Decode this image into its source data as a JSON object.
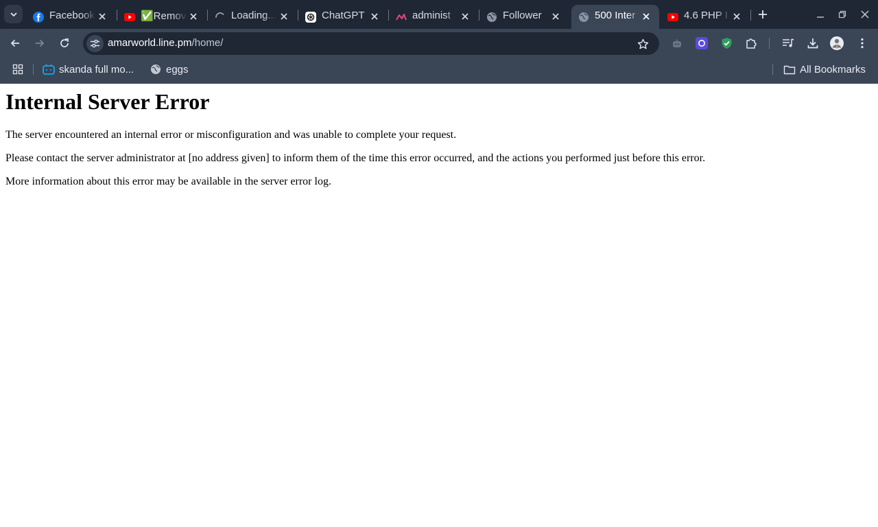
{
  "browser": {
    "tabs": [
      {
        "title": "Facebook",
        "icon": "facebook-icon"
      },
      {
        "title": "✅Remove",
        "icon": "youtube-icon"
      },
      {
        "title": "Loading...",
        "icon": "loading-spinner-icon"
      },
      {
        "title": "ChatGPT",
        "icon": "chatgpt-icon"
      },
      {
        "title": "administ",
        "icon": "analytics-icon"
      },
      {
        "title": "Follower",
        "icon": "globe-icon"
      },
      {
        "title": "500 Inter",
        "icon": "globe-icon",
        "active": true
      },
      {
        "title": "4.6 PHP I",
        "icon": "youtube-icon"
      }
    ],
    "address_bar": {
      "host": "amarworld.line.pm",
      "path": "/home/"
    },
    "bookmarks": [
      {
        "label": "skanda full mo...",
        "icon": "bilibili-icon"
      },
      {
        "label": "eggs",
        "icon": "globe-icon"
      }
    ],
    "all_bookmarks_label": "All Bookmarks"
  },
  "page": {
    "heading": "Internal Server Error",
    "paragraphs": [
      "The server encountered an internal error or misconfiguration and was unable to complete your request.",
      "Please contact the server administrator at [no address given] to inform them of the time this error occurred, and the actions you performed just before this error.",
      "More information about this error may be available in the server error log."
    ]
  },
  "colors": {
    "tabstrip_bg": "#1f2735",
    "toolbar_bg": "#3a4556",
    "omnibox_bg": "#1f2735",
    "youtube_red": "#ff0000",
    "facebook_blue": "#1877f2",
    "security_green": "#2e9e5b",
    "extension_purple": "#5b4bdb"
  }
}
